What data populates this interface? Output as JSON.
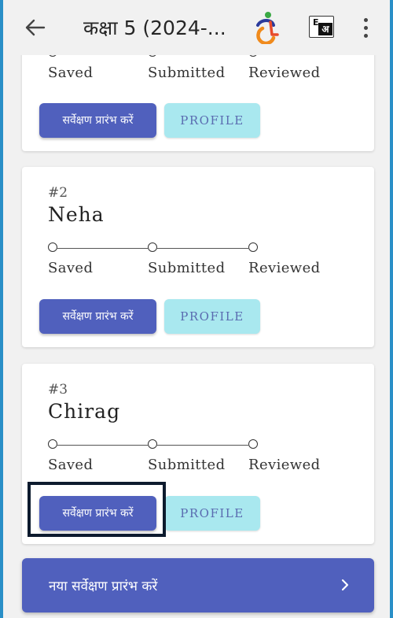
{
  "app_bar": {
    "title": "कक्षा 5 (2024-...",
    "lang_e": "E",
    "lang_a": "अ"
  },
  "stepper_labels": {
    "saved": "Saved",
    "submitted": "Submitted",
    "reviewed": "Reviewed"
  },
  "students": [
    {
      "number": "",
      "name": "",
      "start_survey_label": "सर्वेक्षण प्रारंभ करें",
      "profile_label": "PROFILE"
    },
    {
      "number": "#2",
      "name": "Neha",
      "start_survey_label": "सर्वेक्षण प्रारंभ करें",
      "profile_label": "PROFILE"
    },
    {
      "number": "#3",
      "name": "Chirag",
      "start_survey_label": "सर्वेक्षण प्रारंभ करें",
      "profile_label": "PROFILE"
    }
  ],
  "new_survey": {
    "label": "नया सर्वेक्षण प्रारंभ करें"
  },
  "colors": {
    "primary": "#5060bd",
    "secondary": "#a9e8ef",
    "background": "#f1f1f1",
    "outer_frame": "#2a8fc7"
  }
}
